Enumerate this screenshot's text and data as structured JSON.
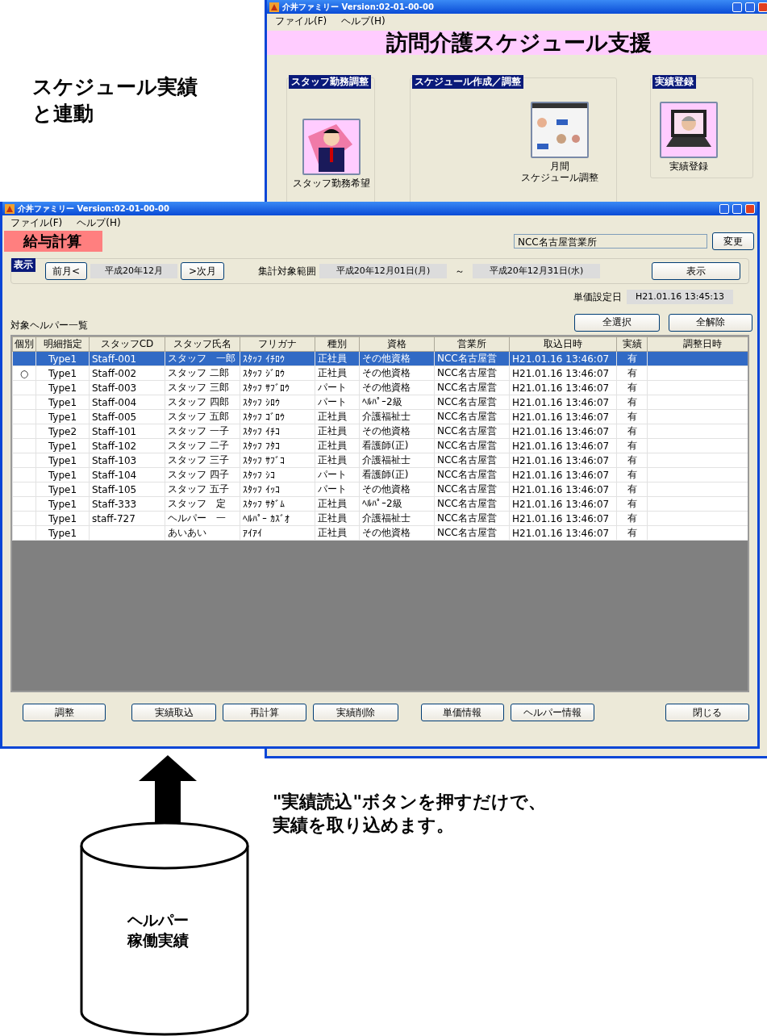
{
  "background_window": {
    "title": "介丼ファミリー Version:02-01-00-00",
    "menu": [
      "ファイル(F)",
      "ヘルプ(H)"
    ],
    "banner": "訪問介護スケジュール支援",
    "groups": [
      {
        "label": "スタッフ勤務調整",
        "items": [
          {
            "lines": [
              "スタッフ勤務希望"
            ]
          }
        ]
      },
      {
        "label": "スケジュール作成／調整",
        "items": [
          {
            "lines": [
              "月間",
              "スケジュール調整"
            ]
          }
        ]
      },
      {
        "label": "実績登録",
        "items": [
          {
            "lines": [
              "実績登録"
            ]
          }
        ]
      }
    ]
  },
  "annotation_top": [
    "スケジュール実績",
    "と連動"
  ],
  "window": {
    "title": "介丼ファミリー Version:02-01-00-00",
    "menu": [
      "ファイル(F)",
      "ヘルプ(H)"
    ],
    "header": "給与計算",
    "office_field": {
      "value": "NCC名古屋営業所"
    },
    "change_button": "変更",
    "panel": {
      "label": "表示",
      "prev_button": "前月<",
      "month": "平成20年12月",
      "next_button": ">次月",
      "range_label": "集計対象範囲",
      "range_from": "平成20年12月01日(月)",
      "tilde": "～",
      "range_to": "平成20年12月31日(水)",
      "show_button": "表示"
    },
    "unit_date_label": "単価設定日",
    "unit_date": "H21.01.16 13:45:13",
    "list_label": "対象ヘルパー一覧",
    "select_all": "全選択",
    "clear_all": "全解除",
    "table": {
      "columns": [
        "個別",
        "明細指定",
        "スタッフCD",
        "スタッフ氏名",
        "フリガナ",
        "種別",
        "資格",
        "営業所",
        "取込日時",
        "実績",
        "調整日時"
      ],
      "rows": [
        {
          "selected": true,
          "type": "Type1",
          "code": "Staff-001",
          "name": "スタッフ　一郎",
          "kana": "ｽﾀｯﾌ ｲﾁﾛｳ",
          "category": "正社員",
          "qualification": "その他資格",
          "office": "NCC名古屋営",
          "imported": "H21.01.16 13:46:07",
          "result": "有"
        },
        {
          "selected": false,
          "individual": "○",
          "type": "Type1",
          "code": "Staff-002",
          "name": "スタッフ 二郎",
          "kana": "ｽﾀｯﾌ ｼﾞﾛｳ",
          "category": "正社員",
          "qualification": "その他資格",
          "office": "NCC名古屋営",
          "imported": "H21.01.16 13:46:07",
          "result": "有"
        },
        {
          "selected": false,
          "type": "Type1",
          "code": "Staff-003",
          "name": "スタッフ 三郎",
          "kana": "ｽﾀｯﾌ ｻﾌﾞﾛｳ",
          "category": "パート",
          "qualification": "その他資格",
          "office": "NCC名古屋営",
          "imported": "H21.01.16 13:46:07",
          "result": "有"
        },
        {
          "selected": false,
          "type": "Type1",
          "code": "Staff-004",
          "name": "スタッフ 四郎",
          "kana": "ｽﾀｯﾌ ｼﾛｳ",
          "category": "パート",
          "qualification": "ﾍﾙﾊﾟｰ2級",
          "office": "NCC名古屋営",
          "imported": "H21.01.16 13:46:07",
          "result": "有"
        },
        {
          "selected": false,
          "type": "Type1",
          "code": "Staff-005",
          "name": "スタッフ 五郎",
          "kana": "ｽﾀｯﾌ ｺﾞﾛｳ",
          "category": "正社員",
          "qualification": "介護福祉士",
          "office": "NCC名古屋営",
          "imported": "H21.01.16 13:46:07",
          "result": "有"
        },
        {
          "selected": false,
          "type": "Type2",
          "code": "Staff-101",
          "name": "スタッフ 一子",
          "kana": "ｽﾀｯﾌ ｲﾁｺ",
          "category": "正社員",
          "qualification": "その他資格",
          "office": "NCC名古屋営",
          "imported": "H21.01.16 13:46:07",
          "result": "有"
        },
        {
          "selected": false,
          "type": "Type1",
          "code": "Staff-102",
          "name": "スタッフ 二子",
          "kana": "ｽﾀｯﾌ ﾌﾀｺ",
          "category": "正社員",
          "qualification": "看護師(正)",
          "office": "NCC名古屋営",
          "imported": "H21.01.16 13:46:07",
          "result": "有"
        },
        {
          "selected": false,
          "type": "Type1",
          "code": "Staff-103",
          "name": "スタッフ 三子",
          "kana": "ｽﾀｯﾌ ｻﾌﾞｺ",
          "category": "正社員",
          "qualification": "介護福祉士",
          "office": "NCC名古屋営",
          "imported": "H21.01.16 13:46:07",
          "result": "有"
        },
        {
          "selected": false,
          "type": "Type1",
          "code": "Staff-104",
          "name": "スタッフ 四子",
          "kana": "ｽﾀｯﾌ ｼｺ",
          "category": "パート",
          "qualification": "看護師(正)",
          "office": "NCC名古屋営",
          "imported": "H21.01.16 13:46:07",
          "result": "有"
        },
        {
          "selected": false,
          "type": "Type1",
          "code": "Staff-105",
          "name": "スタッフ 五子",
          "kana": "ｽﾀｯﾌ ｲｯｺ",
          "category": "パート",
          "qualification": "その他資格",
          "office": "NCC名古屋営",
          "imported": "H21.01.16 13:46:07",
          "result": "有"
        },
        {
          "selected": false,
          "type": "Type1",
          "code": "Staff-333",
          "name": "スタッフ　定",
          "kana": "ｽﾀｯﾌ ｻﾀﾞﾑ",
          "category": "正社員",
          "qualification": "ﾍﾙﾊﾟｰ2級",
          "office": "NCC名古屋営",
          "imported": "H21.01.16 13:46:07",
          "result": "有"
        },
        {
          "selected": false,
          "type": "Type1",
          "code": "staff-727",
          "name": "ヘルパー　一",
          "kana": "ﾍﾙﾊﾟｰ ｶｽﾞｵ",
          "category": "正社員",
          "qualification": "介護福祉士",
          "office": "NCC名古屋営",
          "imported": "H21.01.16 13:46:07",
          "result": "有"
        },
        {
          "selected": false,
          "type": "Type1",
          "name": "あいあい",
          "kana": "ｱｲｱｲ",
          "category": "正社員",
          "qualification": "その他資格",
          "office": "NCC名古屋営",
          "imported": "H21.01.16 13:46:07",
          "result": "有"
        }
      ]
    },
    "buttons": [
      "調整",
      "実績取込",
      "再計算",
      "実績削除",
      "単価情報",
      "ヘルパー情報",
      "閉じる"
    ]
  },
  "annotation_bottom": [
    "\"実績読込\"ボタンを押すだけで、",
    "実績を取り込めます。"
  ],
  "cylinder_label": [
    "ヘルパー",
    "稼働実績"
  ]
}
